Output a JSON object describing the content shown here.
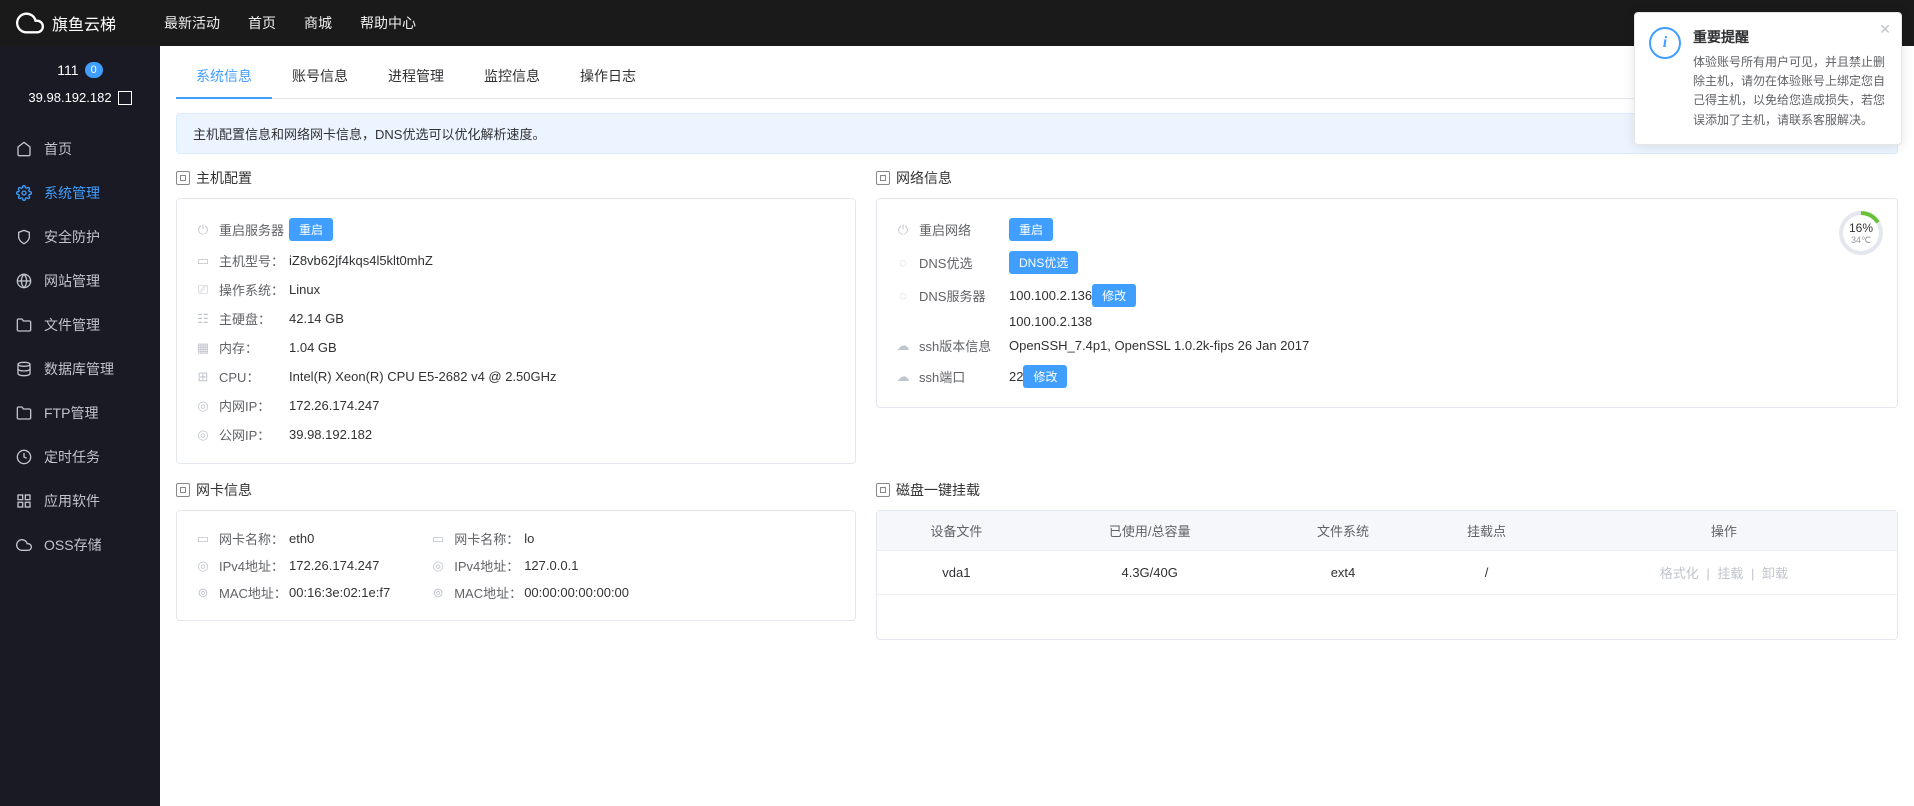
{
  "brand": "旗鱼云梯",
  "topNav": {
    "activity": "最新活动",
    "home": "首页",
    "mall": "商城",
    "help": "帮助中心"
  },
  "notification": {
    "title": "重要提醒",
    "body": "体验账号所有用户可见，并且禁止删除主机，请勿在体验账号上绑定您自己得主机，以免给您造成损失，若您误添加了主机，请联系客服解决。"
  },
  "sidebar": {
    "hostName": "111",
    "hostBadge": "0",
    "hostIp": "39.98.192.182",
    "menu": {
      "home": "首页",
      "system": "系统管理",
      "security": "安全防护",
      "website": "网站管理",
      "files": "文件管理",
      "database": "数据库管理",
      "ftp": "FTP管理",
      "cron": "定时任务",
      "apps": "应用软件",
      "oss": "OSS存储"
    }
  },
  "tabs": {
    "system": "系统信息",
    "account": "账号信息",
    "process": "进程管理",
    "monitor": "监控信息",
    "oplog": "操作日志"
  },
  "alert": "主机配置信息和网络网卡信息，DNS优选可以优化解析速度。",
  "hostConfig": {
    "title": "主机配置",
    "rows": {
      "restartLabel": "重启服务器",
      "restartBtn": "重启",
      "modelLabel": "主机型号：",
      "modelValue": "iZ8vb62jf4kqs4l5klt0mhZ",
      "osLabel": "操作系统：",
      "osValue": "Linux",
      "diskLabel": "主硬盘：",
      "diskValue": "42.14 GB",
      "memLabel": "内存：",
      "memValue": "1.04 GB",
      "cpuLabel": "CPU：",
      "cpuValue": "Intel(R) Xeon(R) CPU E5-2682 v4 @ 2.50GHz",
      "privIpLabel": "内网IP：",
      "privIpValue": "172.26.174.247",
      "pubIpLabel": "公网IP：",
      "pubIpValue": "39.98.192.182"
    }
  },
  "netInfo": {
    "title": "网络信息",
    "gauge": {
      "value": "16%",
      "sub": "34℃"
    },
    "rows": {
      "restartLabel": "重启网络",
      "restartBtn": "重启",
      "dnsOptLabel": "DNS优选",
      "dnsOptBtn": "DNS优选",
      "dnsSrvLabel": "DNS服务器",
      "dnsSrvValue1": "100.100.2.136",
      "dnsSrvValue2": "100.100.2.138",
      "dnsSrvModifyBtn": "修改",
      "sshVerLabel": "ssh版本信息",
      "sshVerValue": "OpenSSH_7.4p1, OpenSSL 1.0.2k-fips 26 Jan 2017",
      "sshPortLabel": "ssh端口",
      "sshPortValue": "22",
      "sshPortModifyBtn": "修改"
    }
  },
  "nic": {
    "title": "网卡信息",
    "cards": {
      "eth0": {
        "nameLabel": "网卡名称：",
        "nameValue": "eth0",
        "ipLabel": "IPv4地址：",
        "ipValue": "172.26.174.247",
        "macLabel": "MAC地址：",
        "macValue": "00:16:3e:02:1e:f7"
      },
      "lo": {
        "nameLabel": "网卡名称：",
        "nameValue": "lo",
        "ipLabel": "IPv4地址：",
        "ipValue": "127.0.0.1",
        "macLabel": "MAC地址：",
        "macValue": "00:00:00:00:00:00"
      }
    }
  },
  "disk": {
    "title": "磁盘一键挂载",
    "headers": {
      "dev": "设备文件",
      "usage": "已使用/总容量",
      "fs": "文件系统",
      "mount": "挂载点",
      "op": "操作"
    },
    "row": {
      "dev": "vda1",
      "usage": "4.3G/40G",
      "fs": "ext4",
      "mount": "/",
      "fmt": "格式化",
      "mnt": "挂载",
      "umnt": "卸载"
    }
  }
}
